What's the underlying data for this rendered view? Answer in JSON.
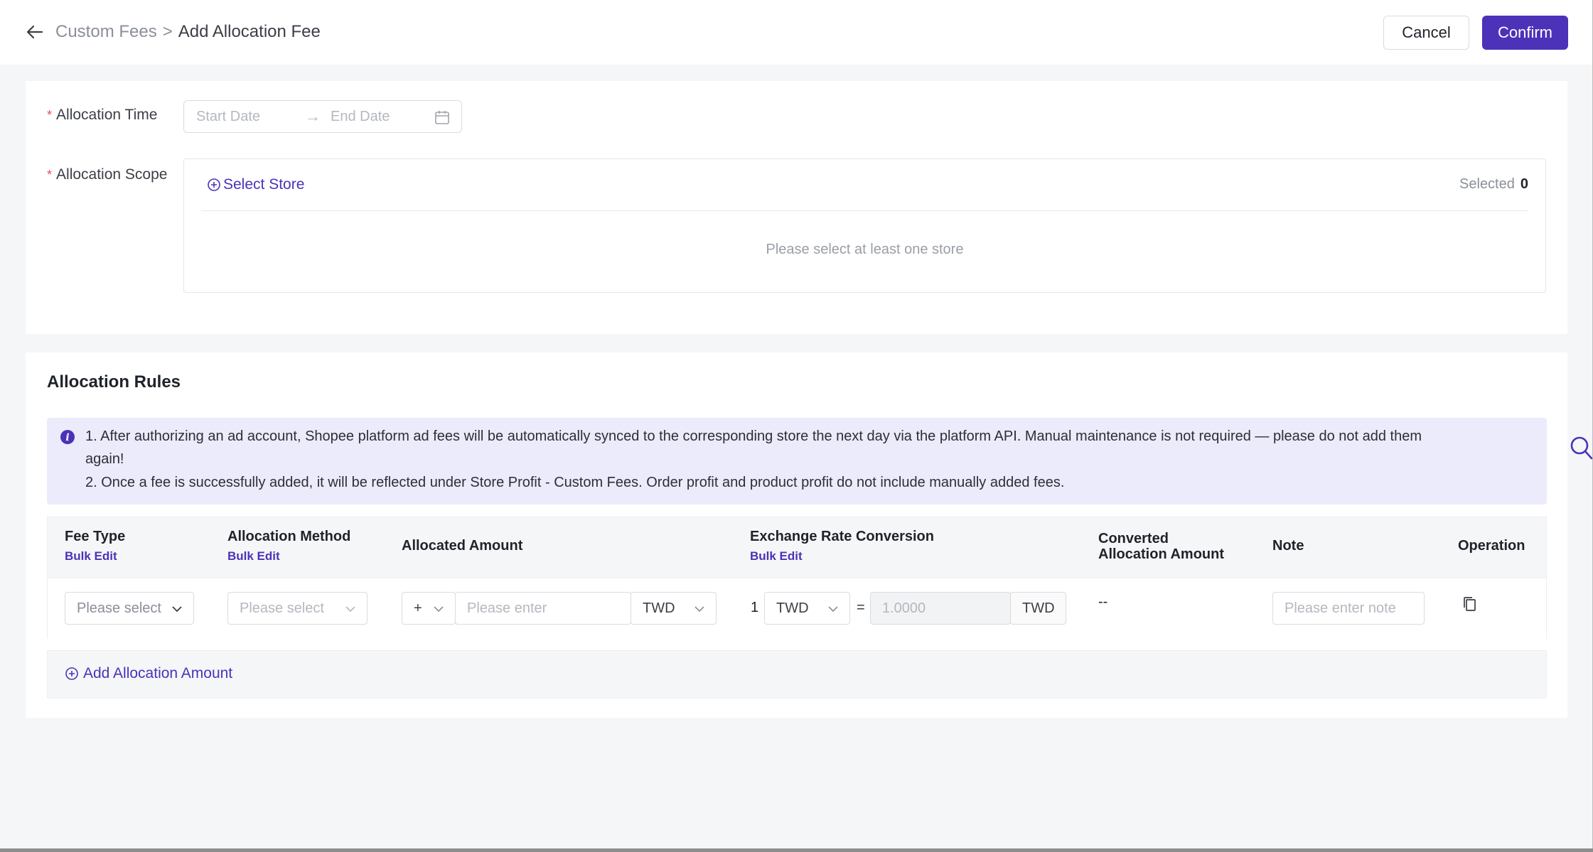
{
  "header": {
    "breadcrumb_parent": "Custom Fees",
    "breadcrumb_separator": ">",
    "breadcrumb_current": "Add Allocation Fee",
    "cancel_label": "Cancel",
    "confirm_label": "Confirm"
  },
  "form": {
    "time_label": "Allocation Time",
    "start_placeholder": "Start Date",
    "end_placeholder": "End Date",
    "range_arrow": "→",
    "scope_label": "Allocation Scope",
    "select_store_label": "Select Store",
    "selected_label": "Selected",
    "selected_count": "0",
    "scope_empty": "Please select at least one store",
    "required_mark": "*"
  },
  "rules": {
    "title": "Allocation Rules",
    "notice_line1": "1. After authorizing an ad account, Shopee platform ad fees will be automatically synced to the corresponding store the next day via the platform API. Manual maintenance is not required — please do not add them",
    "notice_line1b": "again!",
    "notice_line2": "2. Once a fee is successfully added, it will be reflected under Store Profit - Custom Fees. Order profit and product profit do not include manually added fees.",
    "columns": {
      "fee_type": "Fee Type",
      "allocation_method": "Allocation Method",
      "allocated_amount": "Allocated Amount",
      "exchange_rate": "Exchange Rate Conversion",
      "converted_line1": "Converted",
      "converted_line2": "Allocation Amount",
      "note": "Note",
      "operation": "Operation",
      "bulk_edit": "Bulk Edit"
    },
    "row": {
      "fee_type_placeholder": "Please select",
      "method_placeholder": "Please select",
      "sign_value": "+",
      "amount_placeholder": "Please enter",
      "currency_value": "TWD",
      "rate_one": "1",
      "rate_from_currency": "TWD",
      "equals": "=",
      "rate_value": "1.0000",
      "rate_to_currency": "TWD",
      "converted_value": "--",
      "note_placeholder": "Please enter note"
    },
    "add_amount_label": "Add Allocation Amount"
  },
  "colors": {
    "accent": "#4b32b8",
    "notice_bg": "#ebebfb",
    "required": "#e84f4f"
  },
  "icons": [
    "back-arrow-icon",
    "calendar-icon",
    "plus-circle-icon",
    "info-icon",
    "chevron-down-icon",
    "copy-icon",
    "search-icon"
  ]
}
